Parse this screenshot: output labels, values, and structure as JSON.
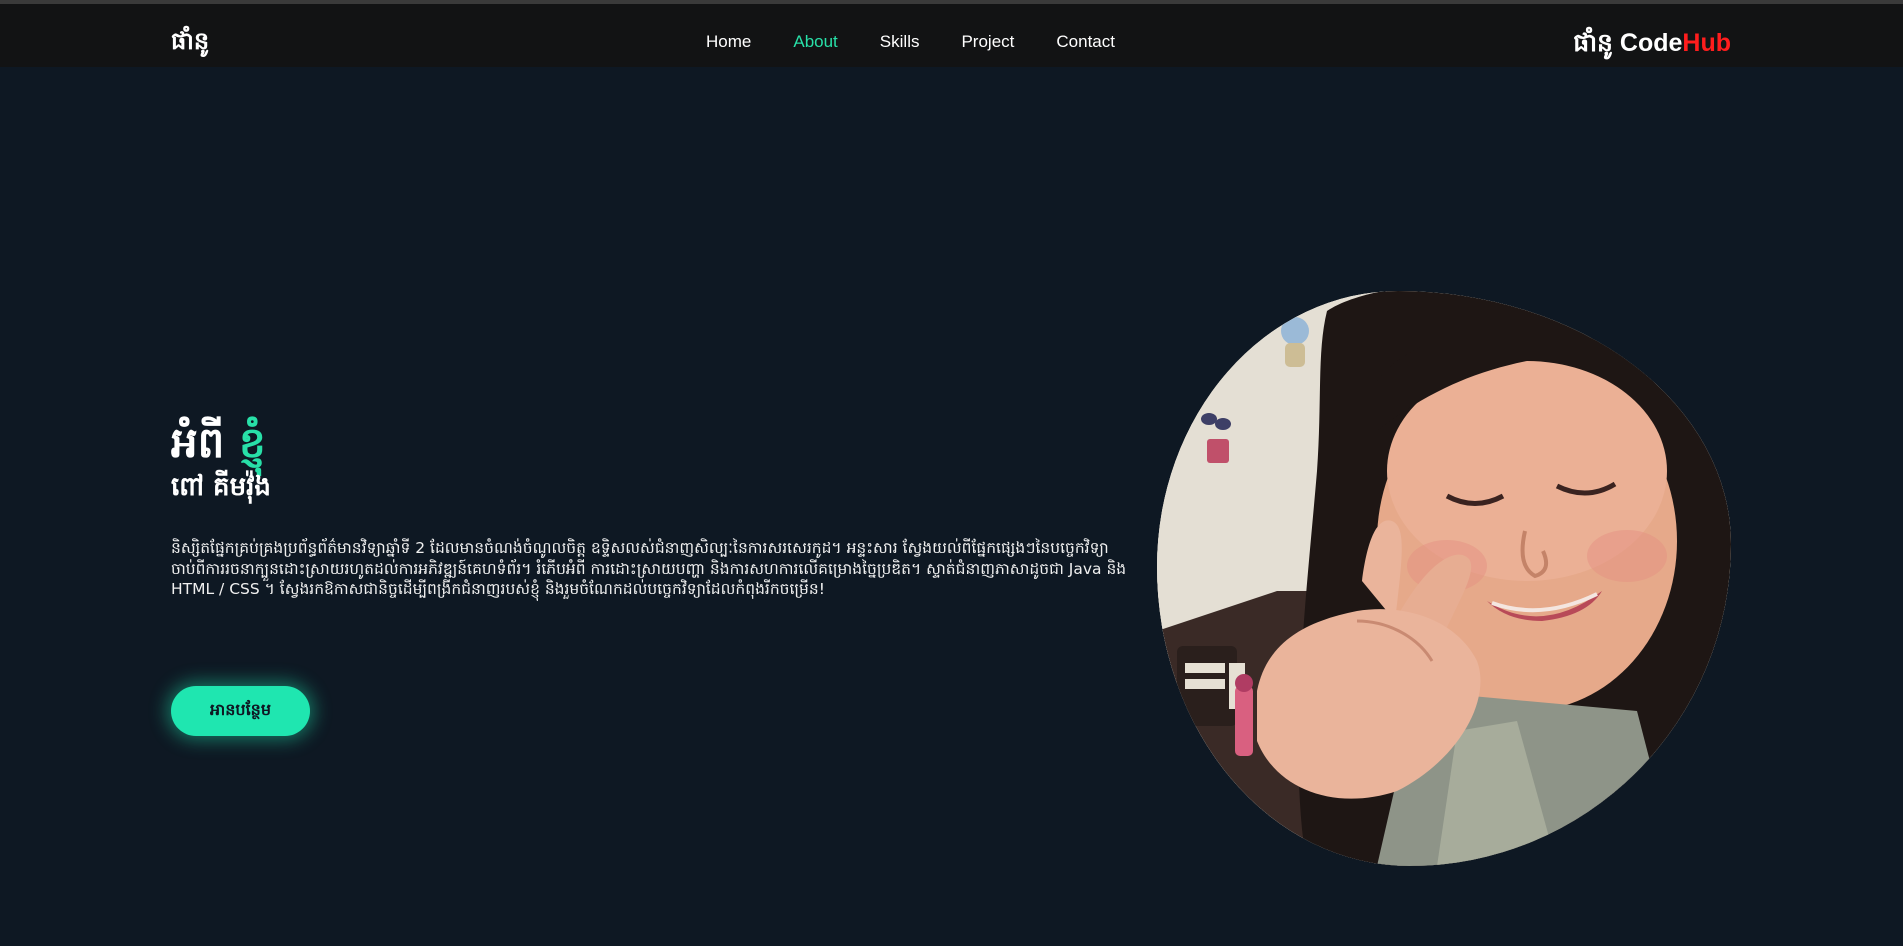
{
  "navbar": {
    "logo": "ផាំនូ",
    "links": [
      {
        "label": "Home",
        "active": false
      },
      {
        "label": "About",
        "active": true
      },
      {
        "label": "Skills",
        "active": false
      },
      {
        "label": "Project",
        "active": false
      },
      {
        "label": "Contact",
        "active": false
      }
    ],
    "brand": {
      "prefix": "ផាំនូ",
      "code": "Code",
      "hub": "Hub"
    }
  },
  "hero": {
    "title_main": "អំពី",
    "title_accent": "ខ្ញុំ",
    "name": "ពៅ គីមវ៉ុង",
    "description": "និស្សិតផ្នែកគ្រប់គ្រងប្រព័ន្ធព័ត៌មានវិទ្យាឆ្នាំទី 2 ដែលមានចំណង់ចំណូលចិត្ត ឧទ្ទិសលស់ជំនាញសិល្បៈនៃការសរសេរកូដ។ អន្ទះសារ ស្វែងយល់ពីផ្នែកផ្សេងៗនៃបច្ចេកវិទ្យា ចាប់ពីការរចនាក្បួនដោះស្រាយរហូតដល់ការអភិវឌ្ឍន៍គេហទំព័រ។ រំភើបអំពី ការដោះស្រាយបញ្ហា និងការសហការលើគម្រោងច្នៃប្រឌិត។ ស្ទាត់ជំនាញភាសាដូចជា Java និង HTML / CSS ។ ស្វែងរកឱកាសជានិច្ចដើម្បីពង្រីកជំនាញរបស់ខ្ញុំ និងរួមចំណែកដល់បច្ចេកវិទ្យាដែលកំពុងរីកចម្រើន!",
    "button_label": "អានបន្ថែម"
  },
  "colors": {
    "accent": "#28e0a8",
    "button": "#1fe6b0",
    "hub": "#ff1d1d",
    "background": "#0e1823",
    "navbar": "#121314"
  }
}
